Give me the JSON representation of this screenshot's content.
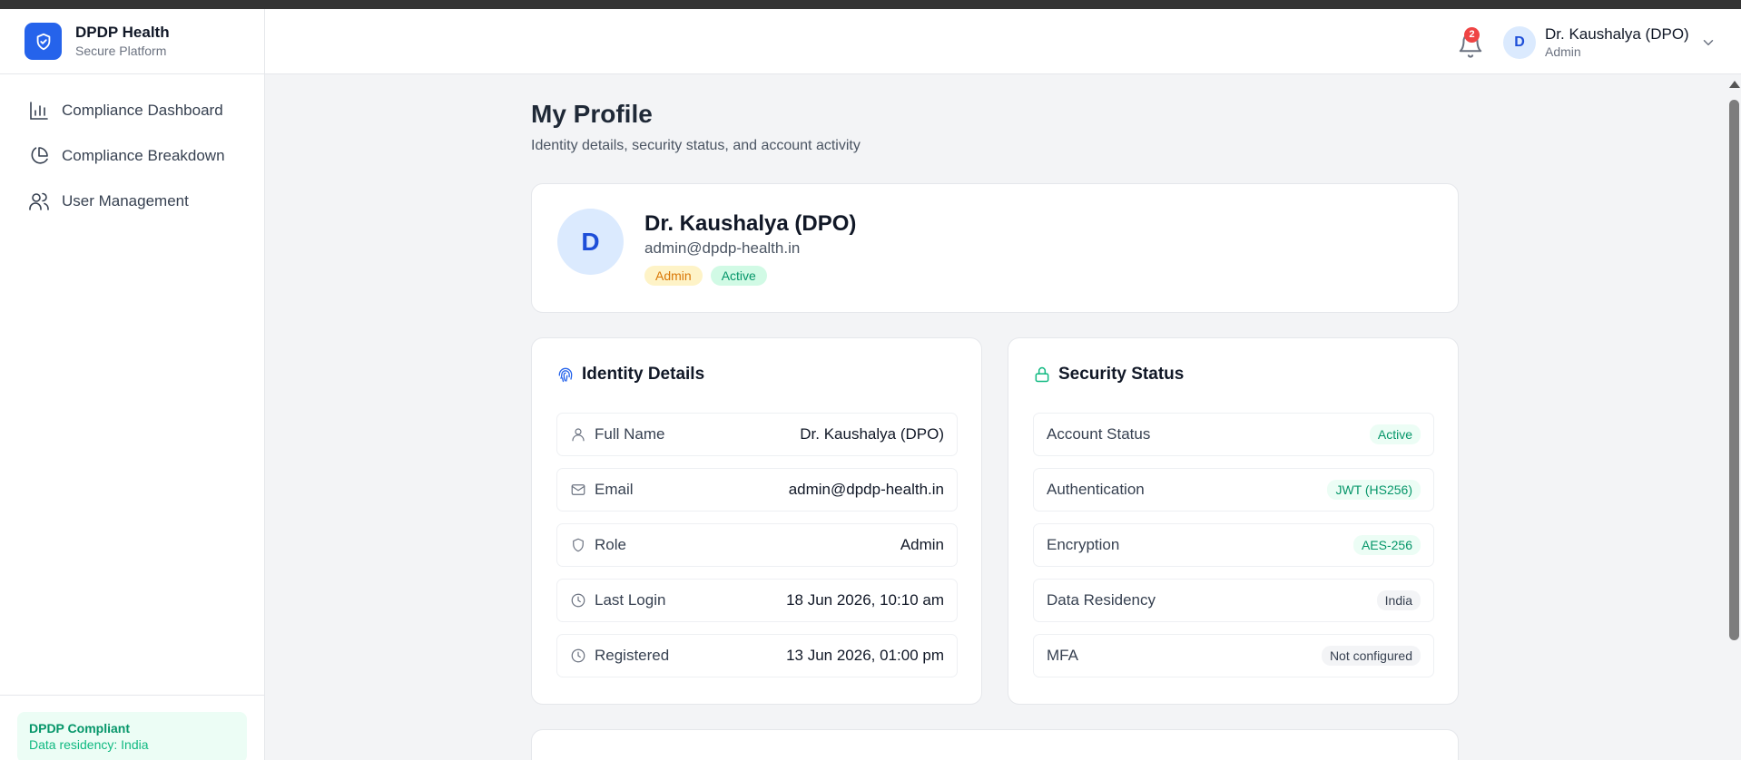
{
  "brand": {
    "title": "DPDP Health",
    "subtitle": "Secure Platform"
  },
  "sidebar": {
    "items": [
      {
        "label": "Compliance Dashboard",
        "icon": "bar-chart-icon"
      },
      {
        "label": "Compliance Breakdown",
        "icon": "pie-chart-icon"
      },
      {
        "label": "User Management",
        "icon": "users-icon"
      }
    ],
    "footer": {
      "title": "DPDP Compliant",
      "subtitle": "Data residency: India"
    }
  },
  "header": {
    "notification_count": "2",
    "user": {
      "initial": "D",
      "name": "Dr. Kaushalya (DPO)",
      "role": "Admin"
    }
  },
  "page": {
    "title": "My Profile",
    "subtitle": "Identity details, security status, and account activity"
  },
  "profile": {
    "initial": "D",
    "name": "Dr. Kaushalya (DPO)",
    "email": "admin@dpdp-health.in",
    "role_badge": "Admin",
    "status_badge": "Active"
  },
  "identity": {
    "title": "Identity Details",
    "rows": [
      {
        "label": "Full Name",
        "value": "Dr. Kaushalya (DPO)",
        "icon": "user-icon"
      },
      {
        "label": "Email",
        "value": "admin@dpdp-health.in",
        "icon": "mail-icon"
      },
      {
        "label": "Role",
        "value": "Admin",
        "icon": "shield-icon"
      },
      {
        "label": "Last Login",
        "value": "18 Jun 2026, 10:10 am",
        "icon": "clock-icon"
      },
      {
        "label": "Registered",
        "value": "13 Jun 2026, 01:00 pm",
        "icon": "clock-icon"
      }
    ]
  },
  "security": {
    "title": "Security Status",
    "rows": [
      {
        "label": "Account Status",
        "value": "Active"
      },
      {
        "label": "Authentication",
        "value": "JWT (HS256)"
      },
      {
        "label": "Encryption",
        "value": "AES-256"
      },
      {
        "label": "Data Residency",
        "value": "India"
      },
      {
        "label": "MFA",
        "value": "Not configured"
      }
    ]
  },
  "colors": {
    "primary": "#2563eb",
    "success": "#059669",
    "warning": "#d97706",
    "danger": "#ef4444"
  }
}
